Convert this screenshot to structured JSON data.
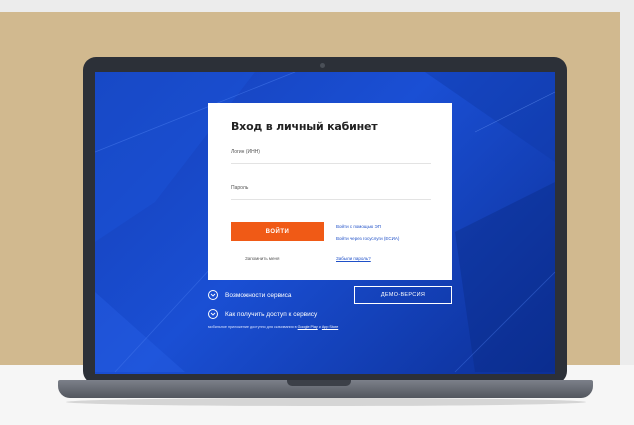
{
  "login": {
    "title": "Вход в личный кабинет",
    "login_label": "Логин (ИНН)",
    "password_label": "Пароль",
    "login_button": "ВОЙТИ",
    "alt_login_ep": "Войти с помощью ЭП",
    "alt_login_esia": "Войти через госуслуги (ЕСИА)",
    "remember": "Запомнить меня",
    "forgot": "Забыли пароль?"
  },
  "features": {
    "capabilities": "Возможности сервиса",
    "access": "Как получить доступ к сервису",
    "demo_button": "ДЕМО-ВЕРСИЯ"
  },
  "footer": {
    "prefix": "мобильное приложение доступно для скачивания в",
    "store1": "Google Play",
    "and": "и",
    "store2": "App Store"
  },
  "icons": {
    "capabilities_icon": "chevron-circle-icon",
    "access_icon": "chevron-circle-icon"
  },
  "colors": {
    "screen_blue": "#1a4fd4",
    "accent_orange": "#f05a16",
    "backdrop_tan": "#d1b98f"
  }
}
